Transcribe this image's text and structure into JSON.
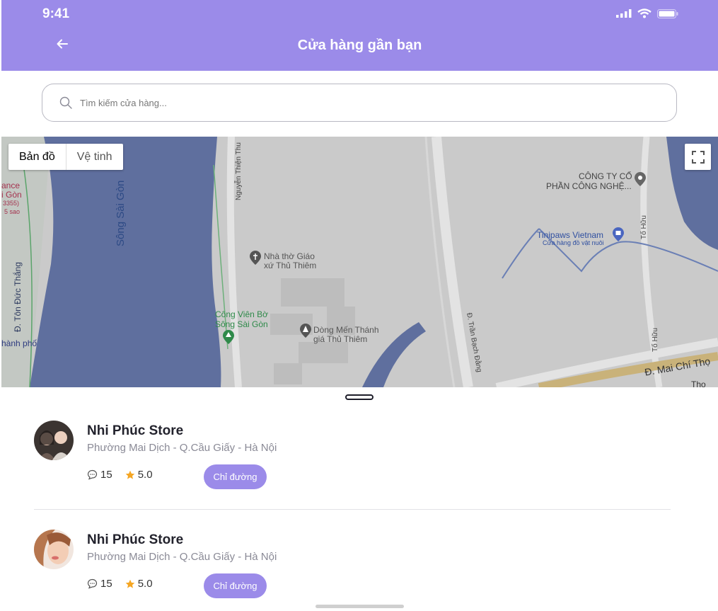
{
  "status": {
    "time": "9:41"
  },
  "header": {
    "title": "Cửa hàng gần bạn",
    "back_icon": "arrow-left-icon"
  },
  "search": {
    "placeholder": "Tìm kiếm cửa hàng...",
    "value": ""
  },
  "map": {
    "tab_map": "Bản đồ",
    "tab_satellite": "Vệ tinh",
    "labels": {
      "song_sai_gon": "Sông Sài Gòn",
      "nguyen_thien_thuat": "Nguyễn Thiện Thu",
      "ton_duc_thang": "Đ. Tôn Đức Thắng",
      "nha_tho_1": "Nhà thờ Giáo",
      "nha_tho_2": "xứ Thủ Thiêm",
      "cong_vien_1": "Công Viên Bờ",
      "cong_vien_2": "Sông Sài Gòn",
      "dong_men_1": "Dòng Mến Thánh",
      "dong_men_2": "giá Thủ Thiêm",
      "cong_ty_1": "CÔNG TY CỔ",
      "cong_ty_2": "PHẦN CÔNG NGHỆ...",
      "tinipaws_1": "Tinipaws Vietnam",
      "tinipaws_2": "Cửa hàng đồ vật nuôi",
      "to_huu_1": "Tố Hữu",
      "to_huu_2": "Tố Hữu",
      "tran_bach_dang": "Đ. Trần Bạch Đằng",
      "mai_chi_tho": "Đ. Mai Chí Thọ",
      "tho": "Thọ",
      "left_1": "ance",
      "left_2": "i Gòn",
      "left_3": "3355)",
      "left_4": "5 sao",
      "left_5": "hành phố"
    }
  },
  "stores": [
    {
      "name": "Nhi Phúc Store",
      "address": "Phường Mai Dịch - Q.Cầu Giấy - Hà Nội",
      "comments": "15",
      "rating": "5.0",
      "button": "Chỉ đường"
    },
    {
      "name": "Nhi Phúc Store",
      "address": "Phường Mai Dịch - Q.Cầu Giấy - Hà Nội",
      "comments": "15",
      "rating": "5.0",
      "button": "Chỉ đường"
    }
  ],
  "colors": {
    "accent": "#9b8be9",
    "star": "#f5a623",
    "text": "#23232d",
    "muted": "#8a8a96"
  }
}
